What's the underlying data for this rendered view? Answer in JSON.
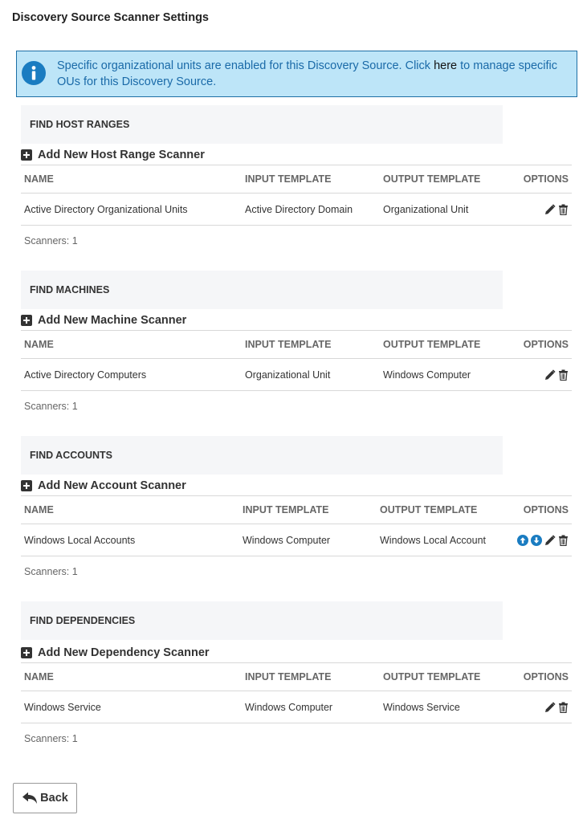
{
  "page": {
    "title": "Discovery Source Scanner Settings"
  },
  "info": {
    "text_before": "Specific organizational units are enabled for this Discovery Source. Click ",
    "link_text": "here",
    "text_after": " to manage specific OUs for this Discovery Source.",
    "icon": "info-icon"
  },
  "columns": {
    "name": "NAME",
    "input_template": "INPUT TEMPLATE",
    "output_template": "OUTPUT TEMPLATE",
    "options": "OPTIONS"
  },
  "sections": [
    {
      "header": "FIND HOST RANGES",
      "add_label": "Add New Host Range Scanner",
      "rows": [
        {
          "name": "Active Directory Organizational Units",
          "input": "Active Directory Domain",
          "output": "Organizational Unit",
          "options": [
            "pencil-icon",
            "trash-icon"
          ]
        }
      ],
      "count": "Scanners: 1"
    },
    {
      "header": "FIND MACHINES",
      "add_label": "Add New Machine Scanner",
      "rows": [
        {
          "name": "Active Directory Computers",
          "input": "Organizational Unit",
          "output": "Windows Computer",
          "options": [
            "pencil-icon",
            "trash-icon"
          ]
        }
      ],
      "count": "Scanners: 1"
    },
    {
      "header": "FIND ACCOUNTS",
      "add_label": "Add New Account Scanner",
      "rows": [
        {
          "name": "Windows Local Accounts",
          "input": "Windows Computer",
          "output": "Windows Local Account",
          "options": [
            "arrow-up-circle-icon",
            "arrow-down-circle-icon",
            "pencil-icon",
            "trash-icon"
          ]
        }
      ],
      "count": "Scanners: 1"
    },
    {
      "header": "FIND DEPENDENCIES",
      "add_label": "Add New Dependency Scanner",
      "rows": [
        {
          "name": "Windows Service",
          "input": "Windows Computer",
          "output": "Windows Service",
          "options": [
            "pencil-icon",
            "trash-icon"
          ]
        }
      ],
      "count": "Scanners: 1"
    }
  ],
  "back_button": {
    "label": "Back",
    "icon": "back-arrow-icon"
  },
  "colors": {
    "info_background": "#bde5f8",
    "info_border": "#1d6fa5",
    "info_text": "#1a6aa8",
    "info_icon": "#1a7cc1",
    "section_header_background": "#f5f6f8",
    "arrow_icon": "#1a7cc1"
  }
}
